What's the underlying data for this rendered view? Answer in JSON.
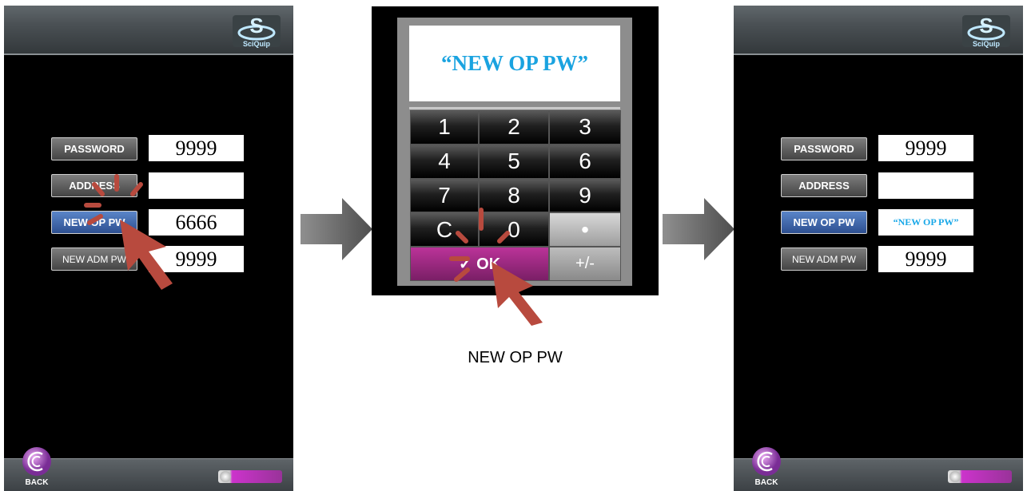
{
  "left_screen": {
    "logo_text": "SciQuip",
    "rows": [
      {
        "label": "PASSWORD",
        "value": "9999"
      },
      {
        "label": "ADDRESS",
        "value": ""
      },
      {
        "label": "NEW OP PW",
        "value": "6666"
      },
      {
        "label": "NEW ADM PW",
        "value": "9999"
      }
    ],
    "back_label": "BACK"
  },
  "keypad": {
    "display_text": "“NEW OP PW”",
    "keys": [
      "1",
      "2",
      "3",
      "4",
      "5",
      "6",
      "7",
      "8",
      "9",
      "C",
      "0",
      "•",
      "✓ OK",
      "+/-"
    ],
    "caption": "NEW OP PW"
  },
  "right_screen": {
    "logo_text": "SciQuip",
    "rows": [
      {
        "label": "PASSWORD",
        "value": "9999"
      },
      {
        "label": "ADDRESS",
        "value": ""
      },
      {
        "label": "NEW OP PW",
        "value": "“NEW OP PW”"
      },
      {
        "label": "NEW ADM PW",
        "value": "9999"
      }
    ],
    "back_label": "BACK"
  },
  "colors": {
    "active_button": "#3a5fa8",
    "ok_key": "#a02a85",
    "display_text": "#1aa3e0",
    "pointer": "#b84a3e"
  }
}
